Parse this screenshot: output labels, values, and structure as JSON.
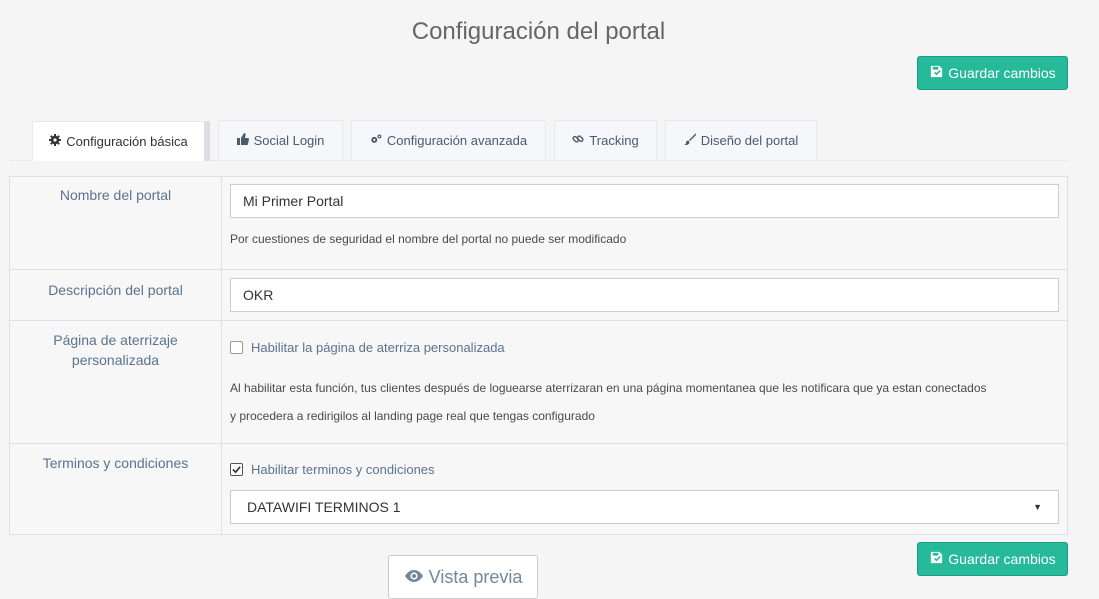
{
  "page": {
    "title": "Configuración del portal"
  },
  "actions": {
    "save_label": "Guardar cambios",
    "preview_label": "Vista previa"
  },
  "tabs": [
    {
      "label": "Configuración básica",
      "icon": "gear-icon",
      "active": true
    },
    {
      "label": "Social Login",
      "icon": "thumbs-up-icon",
      "active": false
    },
    {
      "label": "Configuración avanzada",
      "icon": "gears-icon",
      "active": false
    },
    {
      "label": "Tracking",
      "icon": "link-icon",
      "active": false
    },
    {
      "label": "Diseño del portal",
      "icon": "paintbrush-icon",
      "active": false
    }
  ],
  "form": {
    "name": {
      "label": "Nombre del portal",
      "value": "Mi Primer Portal",
      "help": "Por cuestiones de seguridad el nombre del portal no puede ser modificado"
    },
    "description": {
      "label": "Descripción del portal",
      "value": "OKR"
    },
    "landing": {
      "label": "Página de aterrizaje personalizada",
      "checkbox_label": "Habilitar la página de aterriza personalizada",
      "checked": false,
      "help_line1": "Al habilitar esta función, tus clientes después de loguearse aterrizaran en una página momentanea que les notificara que ya estan conectados",
      "help_line2": "y procedera a redirigilos al landing page real que tengas configurado"
    },
    "terms": {
      "label": "Terminos y condiciones",
      "checkbox_label": "Habilitar terminos y condiciones",
      "checked": true,
      "selected": "DATAWIFI TERMINOS 1"
    }
  },
  "colors": {
    "primary_button": "#26b99a",
    "label_text": "#5a738e"
  }
}
